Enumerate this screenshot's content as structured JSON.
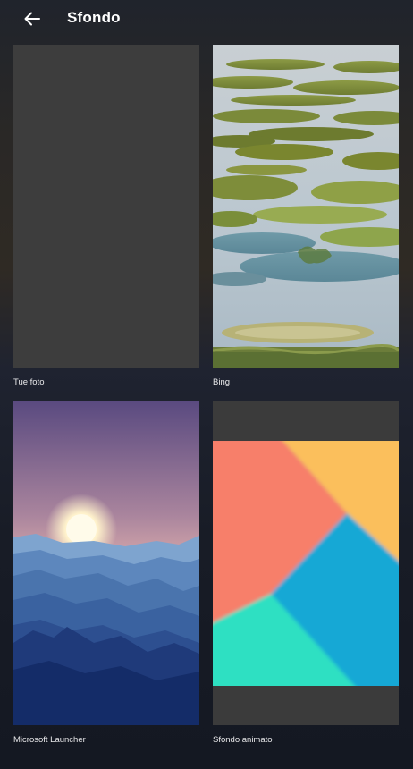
{
  "header": {
    "title": "Sfondo",
    "back_icon": "arrow-left-icon"
  },
  "wallpapers": [
    {
      "label": "Tue foto"
    },
    {
      "label": "Bing"
    },
    {
      "label": "Microsoft Launcher"
    },
    {
      "label": "Sfondo animato"
    }
  ],
  "colors": {
    "placeholder_gray": "#3d3d3d",
    "text": "#ffffff",
    "tri_red": "#f77f6a",
    "tri_yellow": "#fbbf5c",
    "tri_blue": "#13a8d5",
    "tri_teal": "#2ee0c2"
  }
}
